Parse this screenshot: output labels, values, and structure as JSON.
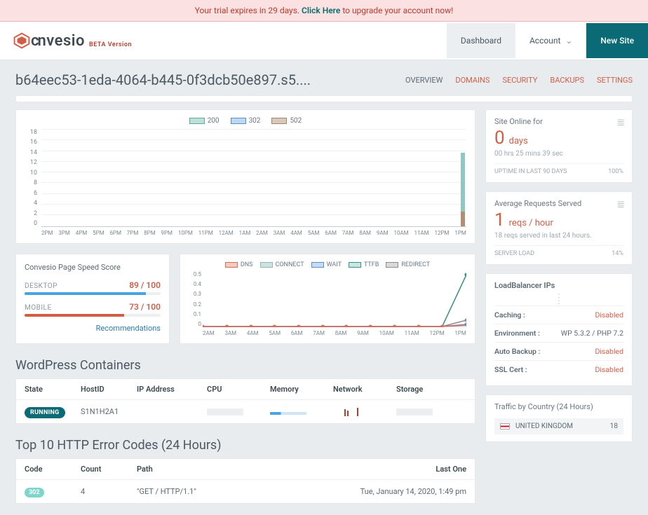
{
  "trial": {
    "prefix": "Your trial expires in 29 days. ",
    "click": "Click Here",
    "suffix": " to upgrade your account now!"
  },
  "brand": {
    "name": "convesio",
    "sub": "BETA Version"
  },
  "nav": {
    "dashboard": "Dashboard",
    "account": "Account",
    "new_site": "New Site"
  },
  "site_id": "b64eec53-1eda-4064-b445-0f3dcb50e897.s5....",
  "tabs": {
    "overview": "OVERVIEW",
    "domains": "DOMAINS",
    "security": "SECURITY",
    "backups": "BACKUPS",
    "settings": "SETTINGS"
  },
  "chart_data": [
    {
      "type": "bar",
      "title": "",
      "series": [
        {
          "name": "200",
          "color_fill": "#bfe0da",
          "color_border": "#5fa89b",
          "values": [
            0,
            0,
            0,
            0,
            0,
            0,
            0,
            0,
            0,
            0,
            0,
            0,
            0,
            0,
            0,
            0,
            0,
            0,
            0,
            0,
            0,
            0,
            0,
            14
          ]
        },
        {
          "name": "302",
          "color_fill": "#bdd8ef",
          "color_border": "#5a8fc6",
          "values": [
            0,
            0,
            0,
            0,
            0,
            0,
            0,
            0,
            0,
            0,
            0,
            0,
            0,
            0,
            0,
            0,
            0,
            0,
            0,
            0,
            0,
            0,
            0,
            0
          ]
        },
        {
          "name": "502",
          "color_fill": "#d9c9bd",
          "color_border": "#a0846c",
          "values": [
            0,
            0,
            0,
            0,
            0,
            0,
            0,
            0,
            0,
            0,
            0,
            0,
            0,
            0,
            0,
            0,
            0,
            0,
            0,
            0,
            0,
            0,
            0,
            3
          ]
        }
      ],
      "categories": [
        "2PM",
        "3PM",
        "4PM",
        "5PM",
        "6PM",
        "7PM",
        "8PM",
        "9PM",
        "10PM",
        "11PM",
        "12AM",
        "1AM",
        "2AM",
        "3AM",
        "4AM",
        "5AM",
        "6AM",
        "7AM",
        "8AM",
        "9AM",
        "10AM",
        "11AM",
        "12PM",
        "1PM"
      ],
      "yticks": [
        0,
        2,
        4,
        6,
        8,
        10,
        12,
        14,
        16,
        18
      ],
      "ylim": [
        0,
        18
      ]
    },
    {
      "type": "line",
      "title": "",
      "series": [
        {
          "name": "DNS",
          "color_fill": "#f3c9c4",
          "color_border": "#d96b5a",
          "values": [
            0,
            0,
            0,
            0,
            0,
            0,
            0,
            0,
            0,
            0,
            0,
            0.02
          ]
        },
        {
          "name": "CONNECT",
          "color_fill": "#cfe1e0",
          "color_border": "#8db9b6",
          "values": [
            0,
            0,
            0,
            0,
            0,
            0,
            0,
            0,
            0,
            0,
            0,
            0.01
          ]
        },
        {
          "name": "WAIT",
          "color_fill": "#c7dbf2",
          "color_border": "#5a8fc6",
          "values": [
            0,
            0,
            0,
            0,
            0,
            0,
            0,
            0,
            0,
            0,
            0,
            0.02
          ]
        },
        {
          "name": "TTFB",
          "color_fill": "#c6e7e2",
          "color_border": "#3d8f85",
          "values": [
            0,
            0,
            0,
            0,
            0,
            0,
            0,
            0,
            0,
            0,
            0,
            0.47
          ]
        },
        {
          "name": "REDIRECT",
          "color_fill": "#d9d9d9",
          "color_border": "#8c8c8c",
          "values": [
            0,
            0,
            0,
            0,
            0,
            0,
            0,
            0,
            0,
            0,
            0,
            0.06
          ]
        }
      ],
      "categories": [
        "2AM",
        "3AM",
        "4AM",
        "5AM",
        "6AM",
        "7AM",
        "8AM",
        "9AM",
        "10AM",
        "11AM",
        "12PM",
        "1PM"
      ],
      "yticks": [
        0,
        0.1,
        0.2,
        0.3,
        0.4,
        0.5
      ],
      "ylim": [
        0,
        0.5
      ]
    }
  ],
  "speed": {
    "title": "Convesio Page Speed Score",
    "desktop_label": "DESKTOP",
    "desktop_score": "89 / 100",
    "desktop_pct": 89,
    "desktop_color": "#4aa3e0",
    "mobile_label": "MOBILE",
    "mobile_score": "73 / 100",
    "mobile_pct": 73,
    "mobile_color": "#d35e48",
    "reco": "Recommendations"
  },
  "containers": {
    "title": "WordPress Containers",
    "headers": {
      "state": "State",
      "host": "HostID",
      "ip": "IP Address",
      "cpu": "CPU",
      "mem": "Memory",
      "net": "Network",
      "stor": "Storage"
    },
    "rows": [
      {
        "state": "RUNNING",
        "host": "S1N1H2A1",
        "ip": ""
      }
    ]
  },
  "errors": {
    "title": "Top 10 HTTP Error Codes (24 Hours)",
    "headers": {
      "code": "Code",
      "count": "Count",
      "path": "Path",
      "last": "Last One"
    },
    "rows": [
      {
        "code": "302",
        "count": "4",
        "path": "\"GET / HTTP/1.1\"",
        "last": "Tue, January 14, 2020, 1:49 pm"
      }
    ]
  },
  "uptime": {
    "label": "Site Online for",
    "value": "0",
    "unit": "days",
    "sub": "00 hrs 25 mins 39 sec",
    "footer_label": "UPTIME IN LAST 90 DAYS",
    "footer_value": "100%"
  },
  "requests": {
    "label": "Average Requests Served",
    "value": "1",
    "unit": "reqs / hour",
    "sub": "18 reqs served in last 24 hours.",
    "footer_label": "SERVER LOAD",
    "footer_value": "14%"
  },
  "info": {
    "lb_label": "LoadBalancer IPs",
    "caching_k": "Caching :",
    "caching_v": "Disabled",
    "env_k": "Environment :",
    "env_v": "WP 5.3.2 / PHP 7.2",
    "backup_k": "Auto Backup :",
    "backup_v": "Disabled",
    "ssl_k": "SSL Cert :",
    "ssl_v": "Disabled"
  },
  "traffic": {
    "title": "Traffic by Country (24 Hours)",
    "rows": [
      {
        "country": "UNITED KINGDOM",
        "count": "18"
      }
    ]
  }
}
